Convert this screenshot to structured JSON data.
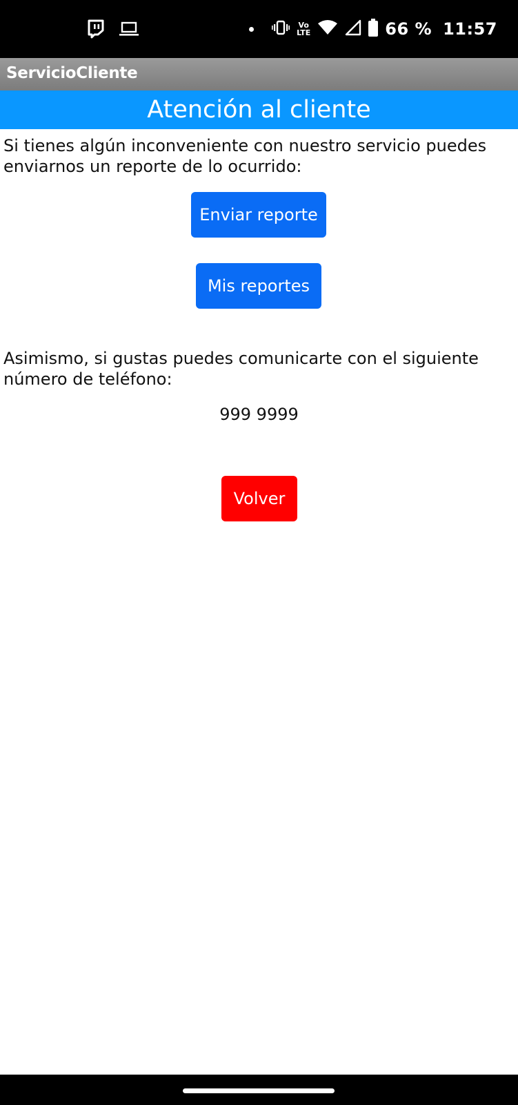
{
  "status_bar": {
    "left_icons": [
      "twitch-icon",
      "laptop-icon"
    ],
    "right_icons": [
      "notification-dot-icon",
      "vibrate-icon",
      "volte-icon",
      "wifi-icon",
      "signal-icon",
      "battery-icon"
    ],
    "volte_top": "Vo",
    "volte_bottom": "LTE",
    "battery_text": "66 %",
    "time": "11:57"
  },
  "app": {
    "title": "ServicioCliente"
  },
  "header": {
    "title": "Atención al cliente"
  },
  "main": {
    "intro_text": "Si tienes algún inconveniente con nuestro servicio puedes enviarnos un reporte de lo ocurrido:",
    "send_report_label": "Enviar reporte",
    "my_reports_label": "Mis reportes",
    "contact_text": "Asimismo, si gustas puedes comunicarte con el siguiente número de teléfono:",
    "phone_number": "999 9999",
    "back_label": "Volver"
  },
  "colors": {
    "action_bar": "#8a8a8a",
    "header_band": "#0a97ff",
    "primary_button": "#0a6cf5",
    "back_button": "#ff0000"
  }
}
